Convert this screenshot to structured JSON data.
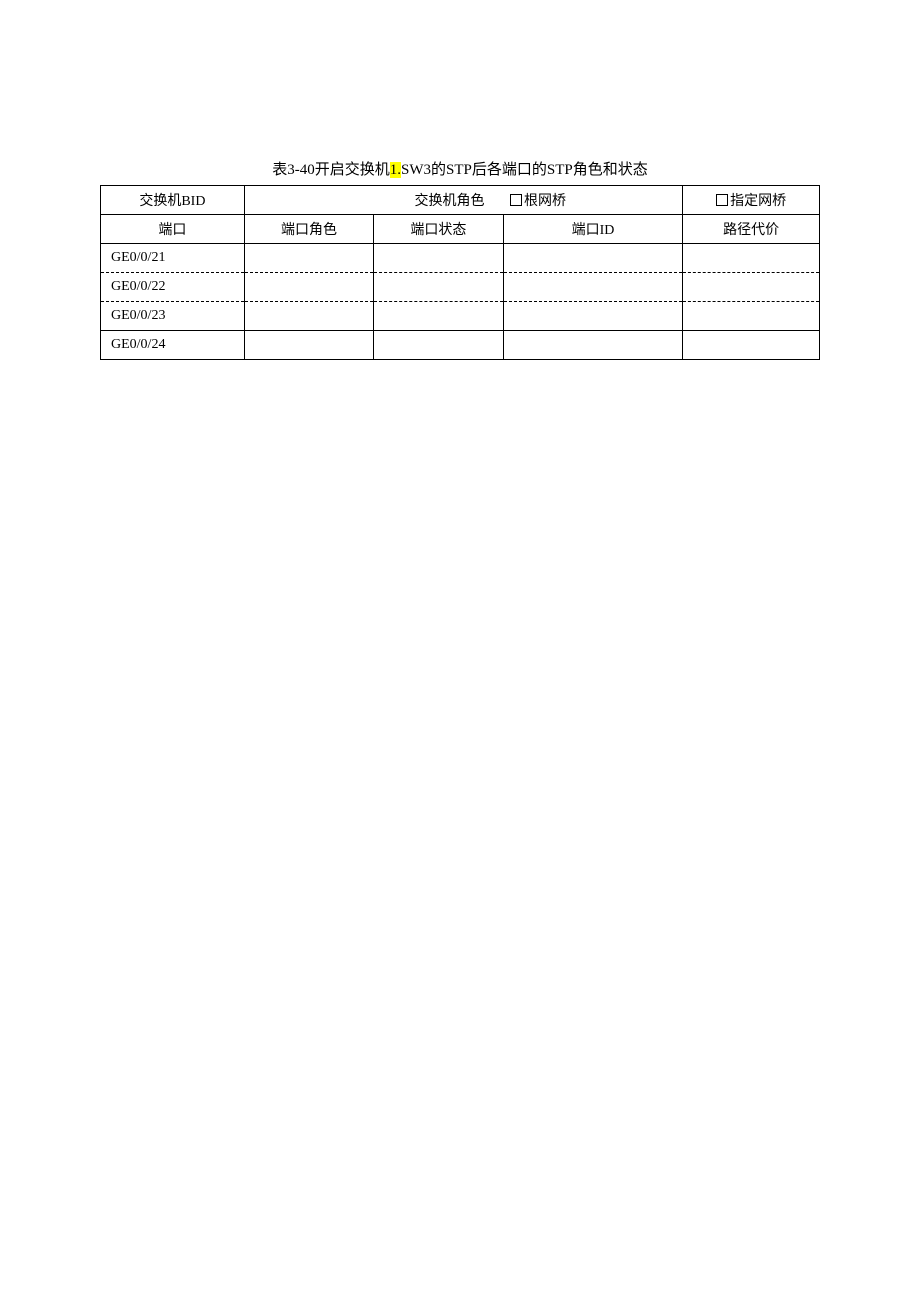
{
  "caption_prefix": "表3-40开启交换机",
  "caption_highlight": "1.",
  "caption_suffix": "SW3的STP后各端口的STP角色和状态",
  "row1": {
    "switch_bid_label": "交换机BID",
    "switch_role_label": "交换机角色",
    "root_bridge_label": "根网桥",
    "designated_bridge_label": "指定网桥"
  },
  "header": {
    "port": "端口",
    "port_role": "端口角色",
    "port_state": "端口状态",
    "port_id": "端口ID",
    "path_cost": "路径代价"
  },
  "rows": [
    {
      "port": "GE0/0/21",
      "role": "",
      "state": "",
      "id": "",
      "cost": ""
    },
    {
      "port": "GE0/0/22",
      "role": "",
      "state": "",
      "id": "",
      "cost": ""
    },
    {
      "port": "GE0/0/23",
      "role": "",
      "state": "",
      "id": "",
      "cost": ""
    },
    {
      "port": "GE0/0/24",
      "role": "",
      "state": "",
      "id": "",
      "cost": ""
    }
  ]
}
